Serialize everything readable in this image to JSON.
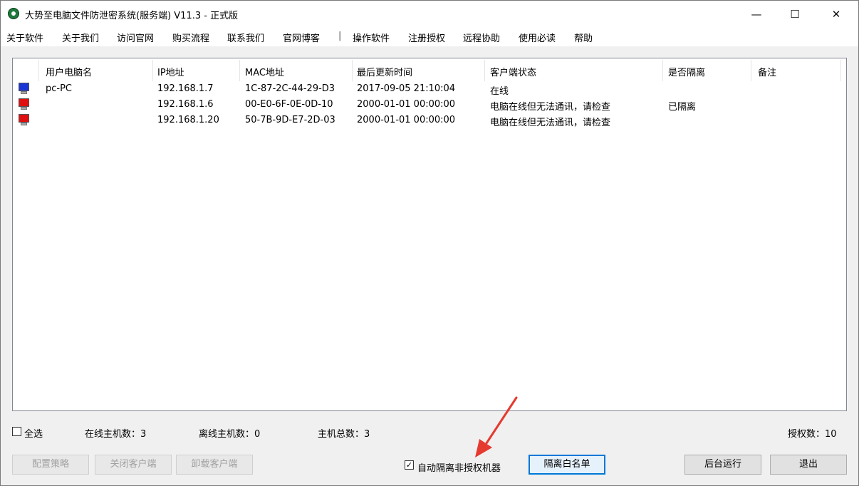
{
  "window": {
    "title": "大势至电脑文件防泄密系统(服务端) V11.3 - 正式版",
    "min": "—",
    "max": "☐",
    "close": "✕"
  },
  "menu": [
    "关于软件",
    "关于我们",
    "访问官网",
    "购买流程",
    "联系我们",
    "官网博客",
    "|",
    "操作软件",
    "注册授权",
    "远程协助",
    "使用必读",
    "帮助"
  ],
  "table": {
    "headers": [
      "用户电脑名",
      "IP地址",
      "MAC地址",
      "最后更新时间",
      "客户端状态",
      "是否隔离",
      "备注"
    ],
    "rows": [
      {
        "icon_color": "#1a35d6",
        "name": "pc-PC",
        "ip": "192.168.1.7",
        "mac": "1C-87-2C-44-29-D3",
        "time": "2017-09-05 21:10:04",
        "status": "在线",
        "isolated": "",
        "note": ""
      },
      {
        "icon_color": "#e01010",
        "name": "",
        "ip": "192.168.1.6",
        "mac": "00-E0-6F-0E-0D-10",
        "time": "2000-01-01 00:00:00",
        "status": "电脑在线但无法通讯，请检查",
        "isolated": "已隔离",
        "note": ""
      },
      {
        "icon_color": "#e01010",
        "name": "",
        "ip": "192.168.1.20",
        "mac": "50-7B-9D-E7-2D-03",
        "time": "2000-01-01 00:00:00",
        "status": "电脑在线但无法通讯，请检查",
        "isolated": "",
        "note": ""
      }
    ]
  },
  "status": {
    "select_all": "全选",
    "online": "在线主机数：3",
    "offline": "离线主机数：0",
    "total": "主机总数：3",
    "license": "授权数：10"
  },
  "buttons": {
    "config": "配置策略",
    "close_client": "关闭客户端",
    "uninstall_client": "卸载客户端",
    "auto_isolate": "自动隔离非授权机器",
    "auto_isolate_checked": true,
    "whitelist": "隔离白名单",
    "background": "后台运行",
    "exit": "退出"
  },
  "accent": "#0078d7",
  "arrow_color": "#e53a2f"
}
